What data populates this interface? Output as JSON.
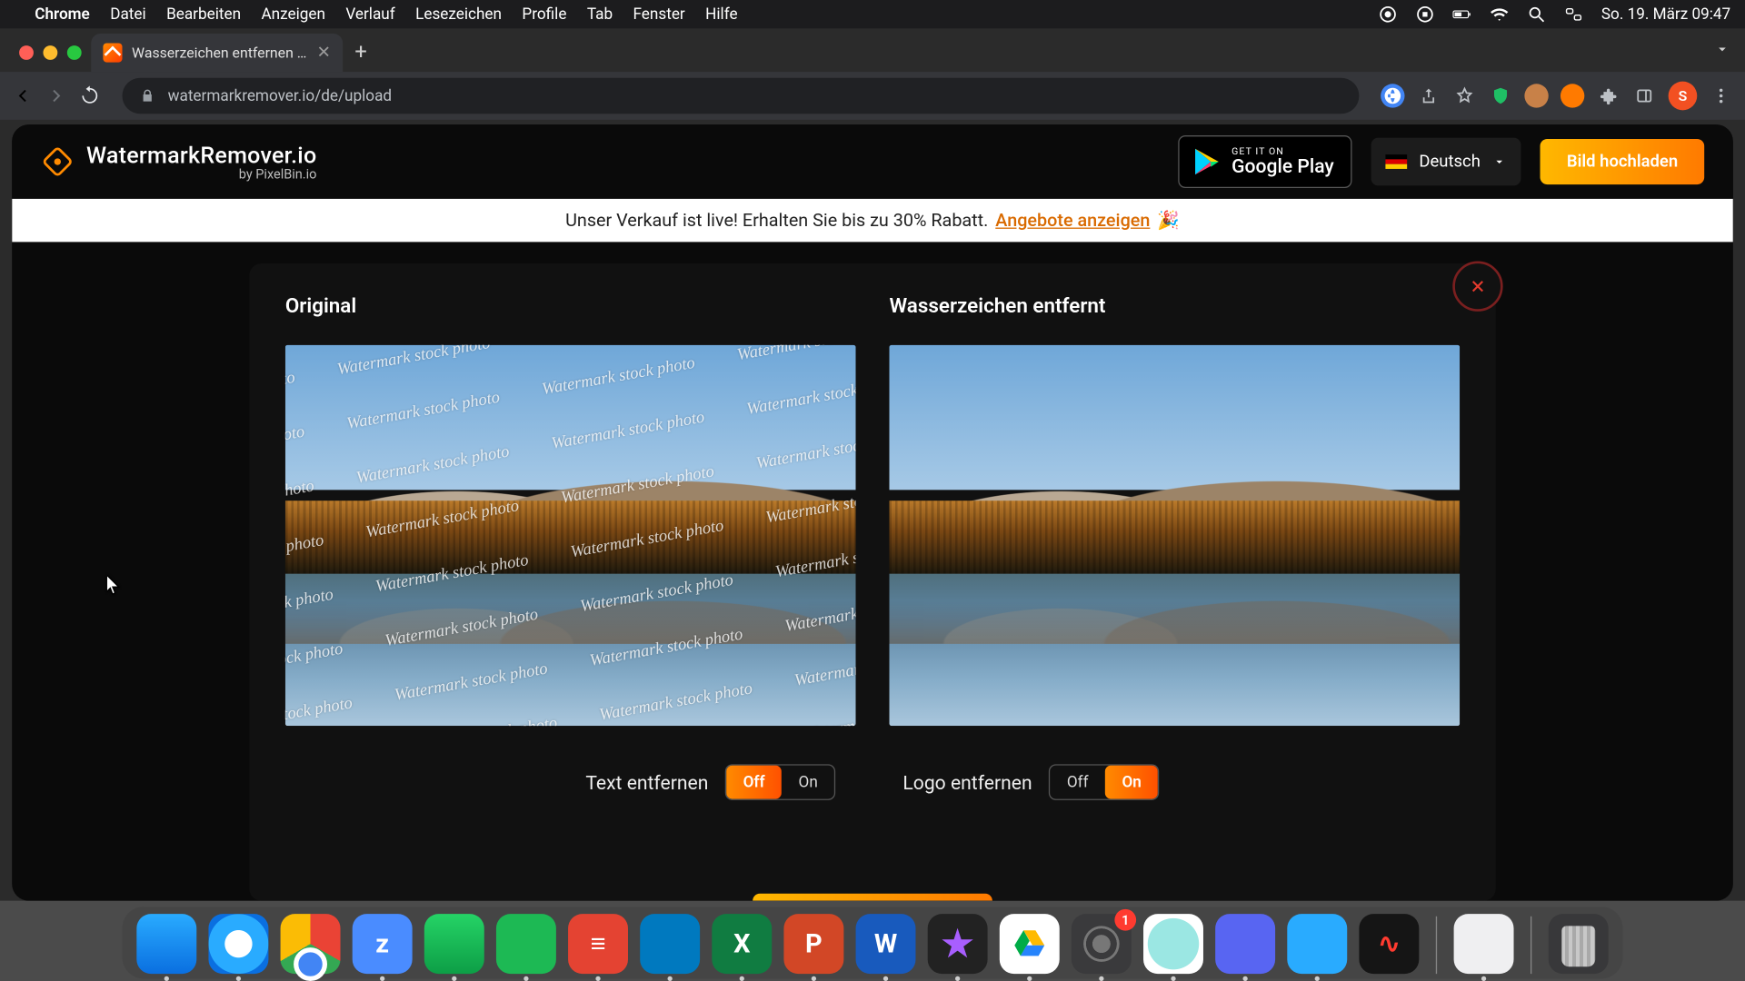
{
  "menubar": {
    "apple": "",
    "app": "Chrome",
    "items": [
      "Datei",
      "Bearbeiten",
      "Anzeigen",
      "Verlauf",
      "Lesezeichen",
      "Profile",
      "Tab",
      "Fenster",
      "Hilfe"
    ],
    "clock": "So. 19. März  09:47"
  },
  "browser": {
    "tab_title": "Wasserzeichen entfernen - Lad…",
    "url": "watermarkremover.io/de/upload",
    "avatar_initial": "S"
  },
  "header": {
    "brand": "WatermarkRemover.io",
    "byline": "by PixelBin.io",
    "gplay_top": "GET IT ON",
    "gplay_bottom": "Google Play",
    "language": "Deutsch",
    "upload": "Bild hochladen"
  },
  "promo": {
    "text": "Unser Verkauf ist live! Erhalten Sie bis zu 30% Rabatt. ",
    "link": "Angebote anzeigen",
    "emoji": "🎉"
  },
  "panel": {
    "original": "Original",
    "removed": "Wasserzeichen entfernt",
    "watermark_text": "Watermark stock photo",
    "toggles": {
      "text_label": "Text entfernen",
      "logo_label": "Logo entfernen",
      "off": "Off",
      "on": "On",
      "text_state": "Off",
      "logo_state": "On"
    }
  },
  "dock": {
    "settings_badge": "1"
  }
}
